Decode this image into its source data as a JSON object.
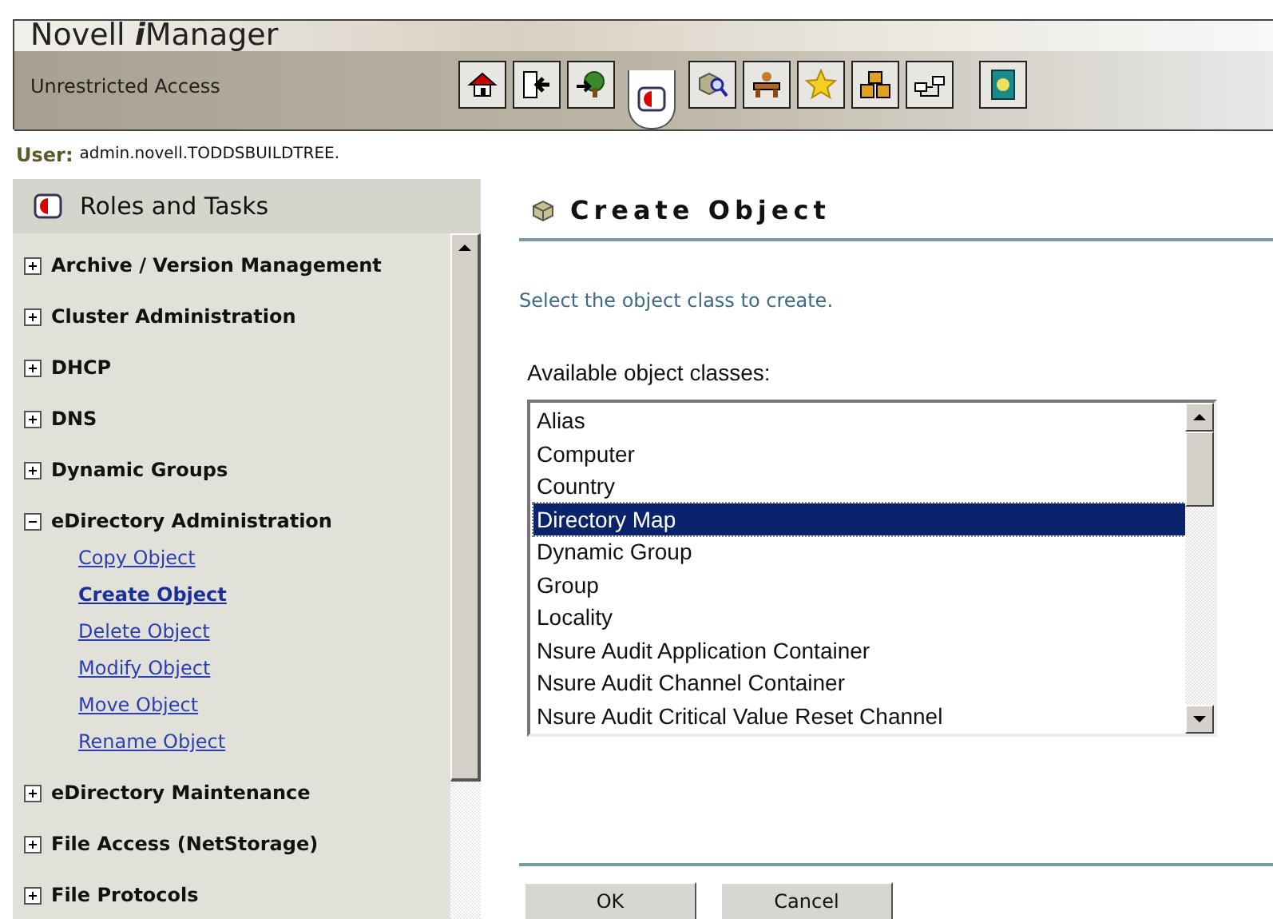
{
  "header": {
    "title_plain": "Novell ",
    "title_italic": "i",
    "title_rest": "Manager",
    "access": "Unrestricted Access"
  },
  "toolbar": [
    {
      "kind": "home",
      "selected": false
    },
    {
      "kind": "exit",
      "selected": false
    },
    {
      "kind": "tree",
      "selected": false
    },
    {
      "kind": "roles",
      "selected": true
    },
    {
      "kind": "search",
      "selected": false
    },
    {
      "kind": "desk",
      "selected": false
    },
    {
      "kind": "star",
      "selected": false
    },
    {
      "kind": "boxes",
      "selected": false
    },
    {
      "kind": "network",
      "selected": false
    },
    {
      "kind": "help",
      "selected": false
    }
  ],
  "user": {
    "label": "User:",
    "value": "admin.novell.TODDSBUILDTREE."
  },
  "sidebar": {
    "title": "Roles and Tasks",
    "items": [
      {
        "label": "Archive / Version Management",
        "expanded": false
      },
      {
        "label": "Cluster Administration",
        "expanded": false
      },
      {
        "label": "DHCP",
        "expanded": false
      },
      {
        "label": "DNS",
        "expanded": false
      },
      {
        "label": "Dynamic Groups",
        "expanded": false
      },
      {
        "label": "eDirectory Administration",
        "expanded": true,
        "children": [
          {
            "label": "Copy Object",
            "selected": false
          },
          {
            "label": "Create Object",
            "selected": true
          },
          {
            "label": "Delete Object",
            "selected": false
          },
          {
            "label": "Modify Object",
            "selected": false
          },
          {
            "label": "Move Object",
            "selected": false
          },
          {
            "label": "Rename Object",
            "selected": false
          }
        ]
      },
      {
        "label": "eDirectory Maintenance",
        "expanded": false
      },
      {
        "label": "File Access (NetStorage)",
        "expanded": false
      },
      {
        "label": "File Protocols",
        "expanded": false
      }
    ]
  },
  "main": {
    "title": "Create Object",
    "instruction": "Select the object class to create.",
    "list_label": "Available object classes:",
    "classes": [
      {
        "label": "Alias",
        "selected": false
      },
      {
        "label": "Computer",
        "selected": false
      },
      {
        "label": "Country",
        "selected": false
      },
      {
        "label": "Directory Map",
        "selected": true
      },
      {
        "label": "Dynamic Group",
        "selected": false
      },
      {
        "label": "Group",
        "selected": false
      },
      {
        "label": "Locality",
        "selected": false
      },
      {
        "label": "Nsure Audit Application Container",
        "selected": false
      },
      {
        "label": "Nsure Audit Channel Container",
        "selected": false
      },
      {
        "label": "Nsure Audit Critical Value Reset Channel",
        "selected": false
      }
    ],
    "buttons": [
      "OK",
      "Cancel"
    ]
  }
}
